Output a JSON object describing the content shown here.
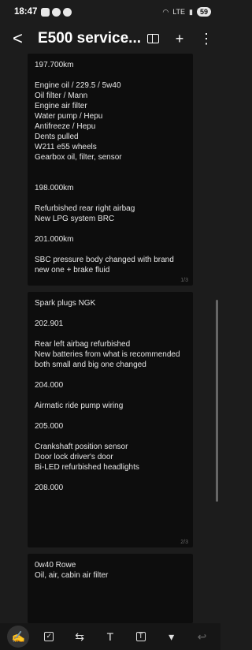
{
  "status": {
    "time": "18:47",
    "battery": "59",
    "signal": "LTE"
  },
  "appbar": {
    "back_glyph": "<",
    "title": "E500 service...",
    "add_glyph": "+",
    "more_glyph": "⋮"
  },
  "pages": [
    {
      "number": "1/3",
      "lines": [
        "197.700km",
        "",
        "Engine oil / 229.5 / 5w40",
        "Oil filter / Mann",
        "Engine air filter",
        "Water pump / Hepu",
        "Antifreeze / Hepu",
        "Dents pulled",
        "W211 e55 wheels",
        "Gearbox oil, filter, sensor",
        "",
        "",
        "198.000km",
        "",
        "Refurbished rear right airbag",
        "New LPG system BRC",
        "",
        "201.000km",
        "",
        "SBC pressure body changed with brand",
        "new one + brake fluid"
      ]
    },
    {
      "number": "2/3",
      "lines": [
        "Spark plugs NGK",
        "",
        "202.901",
        "",
        "Rear left airbag refurbished",
        "New batteries from what is recommended",
        "both small and big one changed",
        "",
        "204.000",
        "",
        "Airmatic ride pump wiring",
        "",
        "205.000",
        "",
        "Crankshaft position sensor",
        "Door lock driver's door",
        "Bi-LED refurbished headlights",
        "",
        "208.000"
      ]
    },
    {
      "number": "",
      "lines": [
        "0w40 Rowe",
        "Oil, air, cabin air filter"
      ]
    }
  ],
  "toolbar": {
    "tools": [
      {
        "name": "pen-tool-icon",
        "glyph": "✍",
        "active": true
      },
      {
        "name": "checkbox-icon",
        "glyph": "✓",
        "active": false
      },
      {
        "name": "text-format-icon",
        "glyph": "⇆",
        "active": false
      },
      {
        "name": "text-style-icon",
        "glyph": "T",
        "active": false
      },
      {
        "name": "text-box-icon",
        "glyph": "T",
        "active": false
      },
      {
        "name": "dropdown-arrow-icon",
        "glyph": "▾",
        "active": false
      },
      {
        "name": "undo-icon",
        "glyph": "↩",
        "active": false
      }
    ]
  }
}
